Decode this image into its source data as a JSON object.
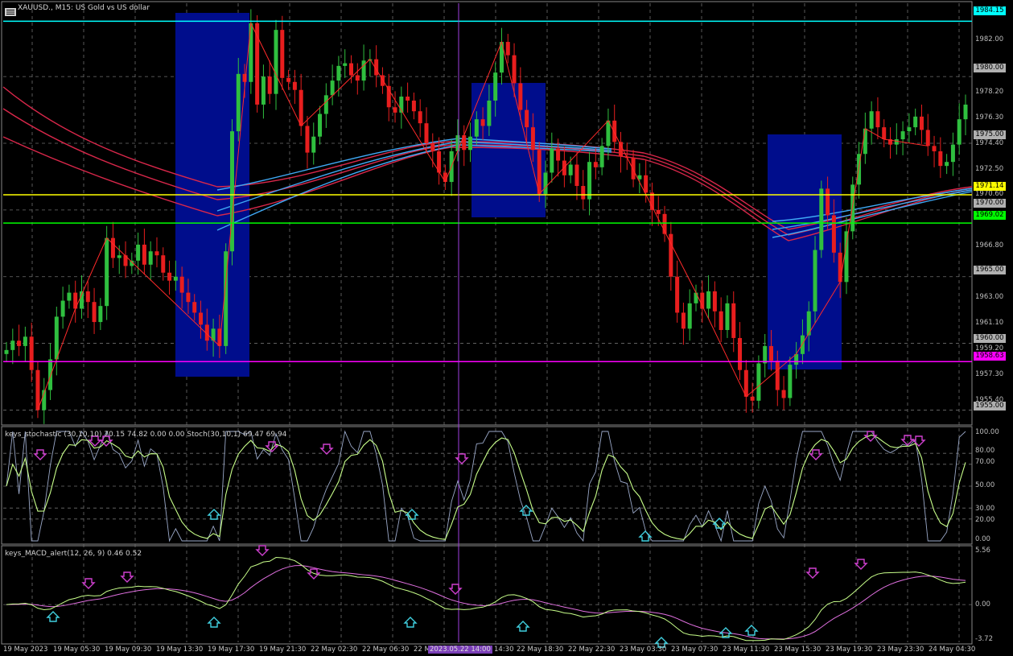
{
  "header": {
    "title": "XAUUSD., M15:  US Gold vs US dollar"
  },
  "panels": {
    "stochastic_title": "keys_stochastic (30,10,10) 70.15 74.82 0.00 0.00 Stoch(30,10,1) 69.47 69.94",
    "macd_title": "keys_MACD_alert(12, 26, 9) 0.46 0.52"
  },
  "price_axis": {
    "labels": [
      "1982.00",
      "1978.20",
      "1976.30",
      "1974.40",
      "1972.50",
      "1970.60",
      "1966.80",
      "1963.00",
      "1961.10",
      "1959.20",
      "1957.30",
      "1955.40"
    ],
    "tags": [
      {
        "text": "1984.15",
        "color": "#00ffff"
      },
      {
        "text": "1980.00",
        "color": "#b0b0b0"
      },
      {
        "text": "1975.00",
        "color": "#b0b0b0"
      },
      {
        "text": "1971.14",
        "color": "#ffff00"
      },
      {
        "text": "1970.00",
        "color": "#b0b0b0"
      },
      {
        "text": "1969.02",
        "color": "#00ff00"
      },
      {
        "text": "1965.00",
        "color": "#b0b0b0"
      },
      {
        "text": "1960.00",
        "color": "#b0b0b0"
      },
      {
        "text": "1958.63",
        "color": "#ff00ff"
      },
      {
        "text": "1955.00",
        "color": "#b0b0b0"
      }
    ]
  },
  "stoch_axis": {
    "labels": [
      "100.00",
      "80.00",
      "70.00",
      "50.00",
      "30.00",
      "20.00",
      "0.00"
    ]
  },
  "macd_axis": {
    "labels": [
      "5.56",
      "0.00",
      "-3.72"
    ]
  },
  "time_axis": {
    "labels": [
      "19 May 2023",
      "19 May 05:30",
      "19 May 09:30",
      "19 May 13:30",
      "19 May 17:30",
      "19 May 21:30",
      "22 May 02:30",
      "22 May 06:30",
      "22 M",
      "14:30",
      "22 May 18:30",
      "22 May 22:30",
      "23 May 03:30",
      "23 May 07:30",
      "23 May 11:30",
      "23 May 15:30",
      "23 May 19:30",
      "23 May 23:30",
      "24 May 04:30"
    ],
    "cursor_label": "2023.05.22 14:00"
  },
  "levels": {
    "resistance": 1984.15,
    "yellow": 1971.14,
    "green": 1969.02,
    "magenta": 1958.63
  },
  "colors": {
    "bull": "#2fbf3f",
    "bear": "#e81e1e",
    "zone": "#000d8c",
    "ma_red": "#d9274a",
    "ma_blue": "#3fa9f5",
    "grid": "#6e6e6e"
  },
  "chart_data": {
    "type": "line",
    "title": "XAUUSD., M15:  US Gold vs US dollar",
    "x_start": "19 May 2023",
    "x_end": "24 May 04:30",
    "ylim": [
      1954.0,
      1985.5
    ],
    "close_series": [
      1959.5,
      1960.2,
      1959.8,
      1960.5,
      1958.0,
      1955.0,
      1956.5,
      1958.8,
      1962.0,
      1963.2,
      1963.8,
      1962.6,
      1963.9,
      1963.1,
      1961.6,
      1962.8,
      1967.9,
      1966.4,
      1966.6,
      1965.8,
      1966.2,
      1967.4,
      1965.9,
      1966.9,
      1966.6,
      1965.3,
      1964.7,
      1965.0,
      1963.8,
      1963.1,
      1962.3,
      1961.4,
      1960.2,
      1961.1,
      1959.8,
      1966.9,
      1975.9,
      1980.2,
      1979.6,
      1984.0,
      1977.9,
      1980.0,
      1978.7,
      1983.5,
      1979.9,
      1979.6,
      1979.0,
      1976.3,
      1974.3,
      1975.5,
      1977.2,
      1978.6,
      1979.7,
      1980.8,
      1981.0,
      1980.1,
      1979.7,
      1981.2,
      1981.3,
      1980.1,
      1979.3,
      1977.7,
      1977.3,
      1978.5,
      1978.2,
      1977.4,
      1976.5,
      1975.0,
      1974.4,
      1972.8,
      1972.1,
      1974.4,
      1975.6,
      1974.5,
      1975.5,
      1976.8,
      1976.3,
      1978.2,
      1980.3,
      1982.6,
      1981.6,
      1979.5,
      1977.5,
      1976.2,
      1974.5,
      1971.2,
      1972.8,
      1974.6,
      1973.7,
      1972.6,
      1973.4,
      1971.8,
      1970.8,
      1973.6,
      1973.2,
      1974.8,
      1976.7,
      1975.1,
      1974.0,
      1973.9,
      1972.3,
      1972.6,
      1971.3,
      1970.0,
      1969.7,
      1968.2,
      1965.0,
      1962.3,
      1961.1,
      1963.0,
      1963.8,
      1962.6,
      1963.9,
      1962.4,
      1961.0,
      1963.0,
      1960.4,
      1958.0,
      1956.0,
      1955.7,
      1958.5,
      1959.8,
      1958.7,
      1956.5,
      1955.9,
      1958.4,
      1959.2,
      1960.6,
      1962.4,
      1967.0,
      1971.6,
      1969.6,
      1966.8,
      1964.6,
      1968.4,
      1971.9,
      1974.2,
      1976.1,
      1977.4,
      1976.2,
      1975.3,
      1974.9,
      1975.3,
      1975.9,
      1976.2,
      1977.0,
      1976.0,
      1974.8,
      1974.4,
      1973.3,
      1973.6,
      1974.9,
      1976.8,
      1977.9
    ]
  }
}
